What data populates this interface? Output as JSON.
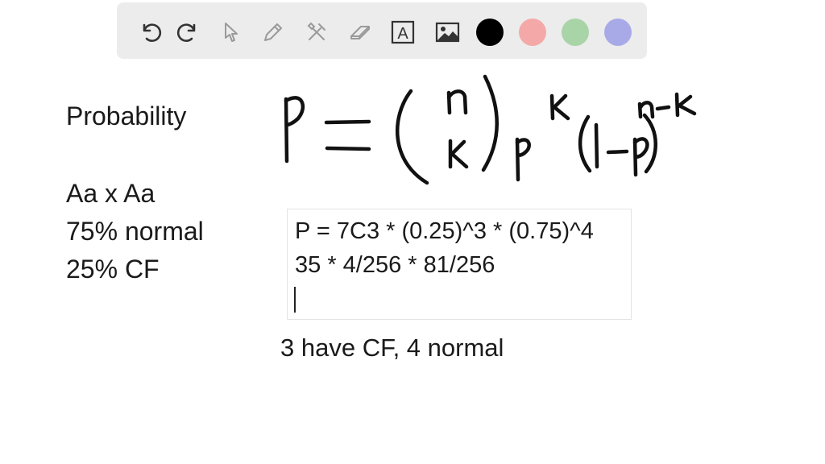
{
  "toolbar": {
    "tools": [
      {
        "name": "undo-icon"
      },
      {
        "name": "redo-icon"
      },
      {
        "name": "select-pointer-icon"
      },
      {
        "name": "pen-icon"
      },
      {
        "name": "tools-icon"
      },
      {
        "name": "eraser-icon"
      },
      {
        "name": "text-tool-icon",
        "label": "A"
      },
      {
        "name": "image-icon"
      }
    ],
    "colors": [
      "#000000",
      "#f4a9a8",
      "#a9d4a7",
      "#a8aae8"
    ]
  },
  "left_notes": {
    "title": "Probability",
    "line1": "Aa x Aa",
    "line2": "75% normal",
    "line3": "25% CF"
  },
  "textbox": {
    "line1": "P = 7C3 * (0.25)^3 * (0.75)^4",
    "line2": "35 * 4/256 * 81/256"
  },
  "below_note": "3 have CF, 4 normal"
}
